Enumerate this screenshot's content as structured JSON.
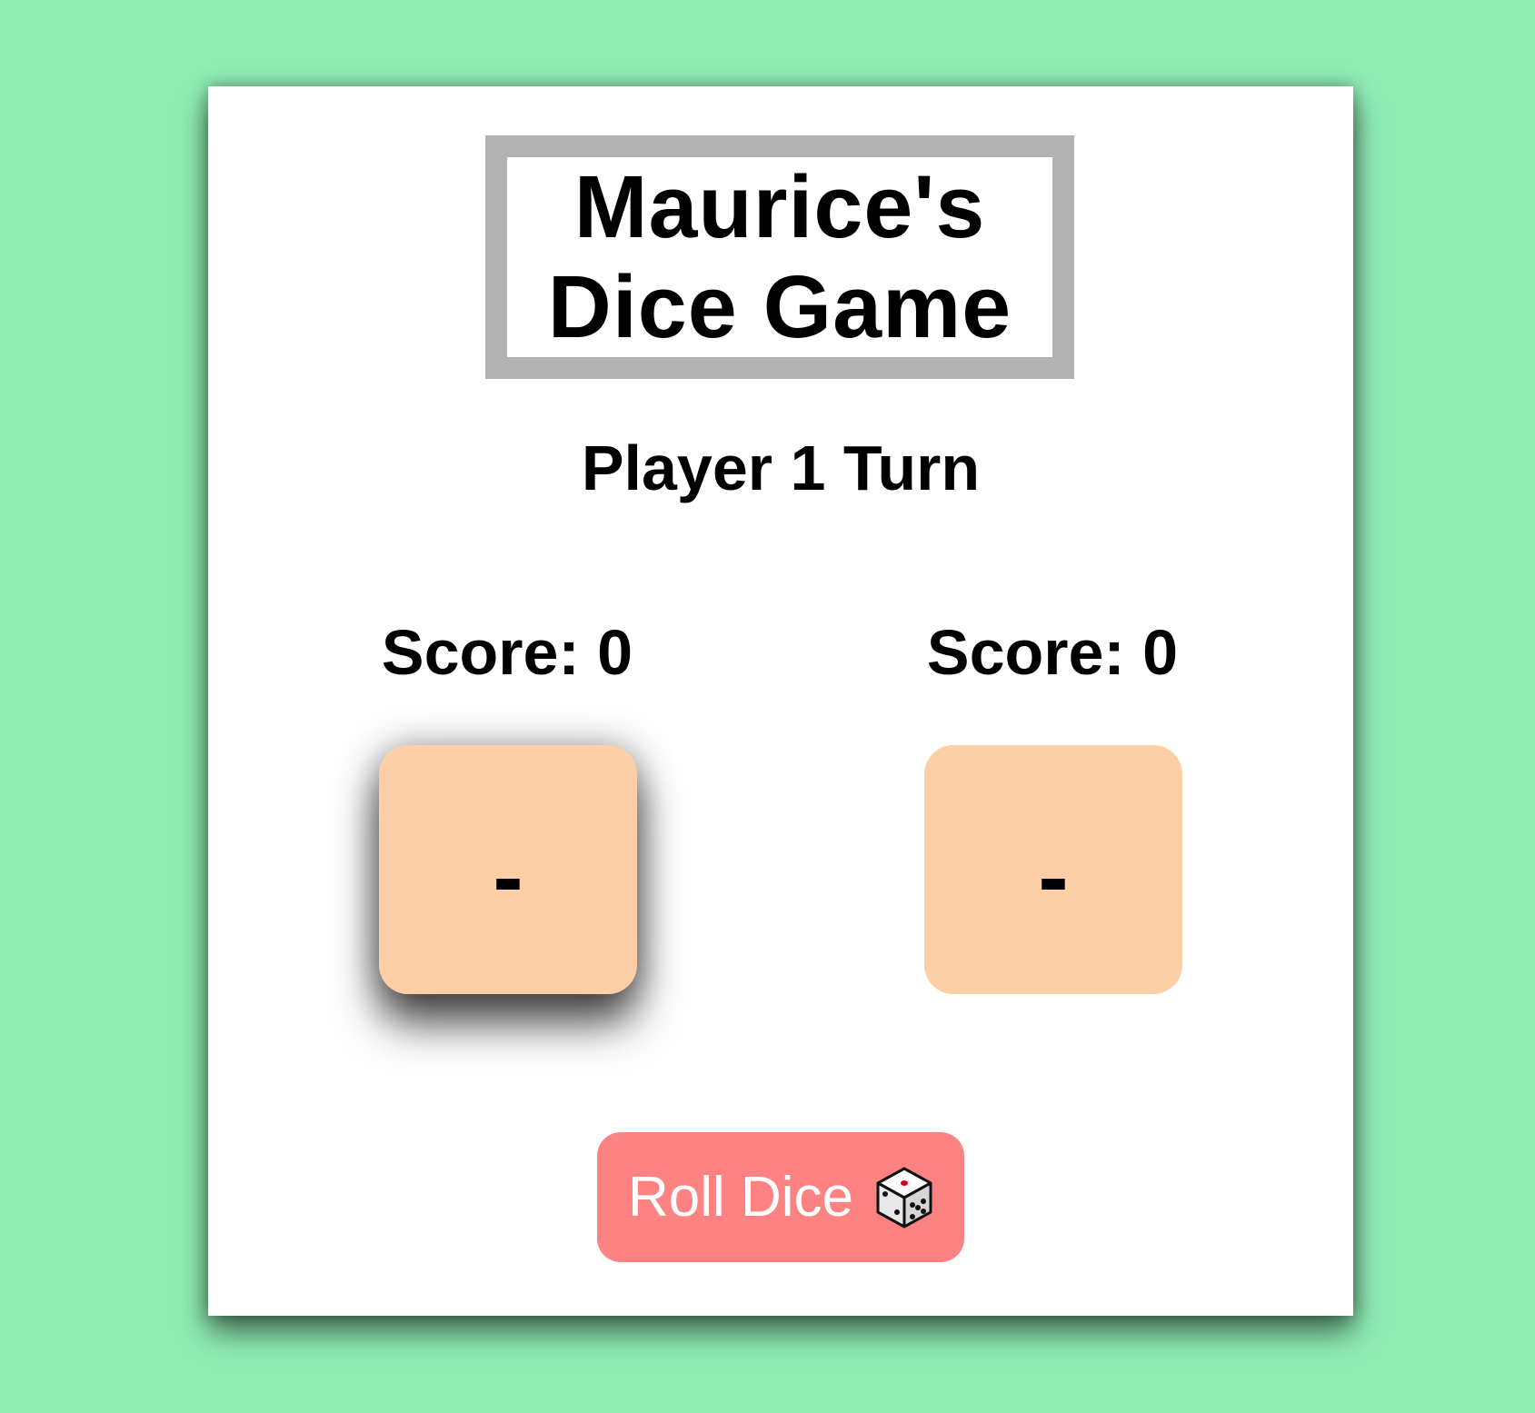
{
  "game": {
    "title": "Maurice's Dice Game",
    "turn_status": "Player 1 Turn"
  },
  "players": [
    {
      "score_label": "Score: 0",
      "die_value": "-",
      "active": true
    },
    {
      "score_label": "Score: 0",
      "die_value": "-",
      "active": false
    }
  ],
  "roll_button": {
    "label": "Roll Dice",
    "icon": "dice-icon"
  },
  "colors": {
    "background": "#90eeb5",
    "card": "#ffffff",
    "title_border": "#b2b2b2",
    "die_face": "#fecfa6",
    "button": "#fd8383",
    "button_text": "#ffffff"
  }
}
